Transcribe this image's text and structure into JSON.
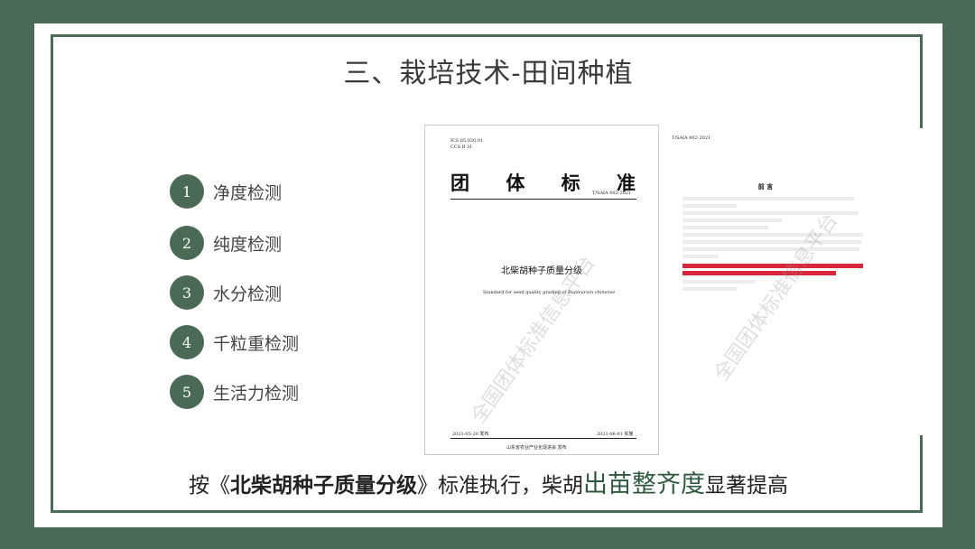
{
  "slide": {
    "title": "三、栽培技术-田间种植",
    "items": [
      {
        "num": "1",
        "label": "净度检测"
      },
      {
        "num": "2",
        "label": "纯度检测"
      },
      {
        "num": "3",
        "label": "水分检测"
      },
      {
        "num": "4",
        "label": "千粒重检测"
      },
      {
        "num": "5",
        "label": "生活力检测"
      }
    ],
    "bottom": {
      "p1": "按《",
      "p2": "北柴胡种子质量分级",
      "p3": "》标准执行，柴胡",
      "p4": "出苗整齐度",
      "p5": "显著提高"
    }
  },
  "doc_cover": {
    "ics": "ICS  65.020.01",
    "ccs": "CCS  B 31",
    "h1": "团",
    "h2": "体",
    "h3": "标",
    "h4": "准",
    "code": "T/SAIA 002-2021",
    "name": "北柴胡种子质量分级",
    "english_a": "Standard for seed quality grading of ",
    "english_b": "Bupleurum chinense",
    "pub_date": "2021-05-20 发布",
    "impl_date": "2021-06-01  实施",
    "issuer": "山东省农业产业化促进会    发布",
    "watermark": "全国团体标准信息平台"
  },
  "doc_foreword": {
    "code": "T/SAIA 002-2021",
    "title": "前    言",
    "watermark": "全国团体标准信息平台"
  }
}
